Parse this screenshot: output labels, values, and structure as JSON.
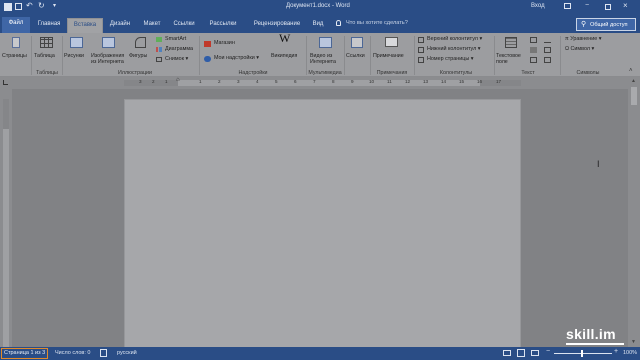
{
  "window": {
    "title": "Документ1.docx - Word",
    "sign_in": "Вход",
    "qat": {
      "save": "save",
      "undo": "undo",
      "redo": "redo"
    }
  },
  "tabs": [
    {
      "label": "Файл"
    },
    {
      "label": "Главная"
    },
    {
      "label": "Вставка"
    },
    {
      "label": "Дизайн"
    },
    {
      "label": "Макет"
    },
    {
      "label": "Ссылки"
    },
    {
      "label": "Рассылки"
    },
    {
      "label": "Рецензирование"
    },
    {
      "label": "Вид"
    }
  ],
  "tell_me": "Что вы хотите сделать?",
  "share": "Общий доступ",
  "ribbon": {
    "pages": {
      "button": "Страницы",
      "group": ""
    },
    "tables": {
      "button": "Таблица",
      "group": "Таблицы"
    },
    "illustrations": {
      "pictures": "Рисунки",
      "online_pictures_1": "Изображения",
      "online_pictures_2": "из Интернета",
      "shapes": "Фигуры",
      "smartart": "SmartArt",
      "chart": "Диаграмма",
      "screenshot": "Снимок",
      "group": "Иллюстрации"
    },
    "addins": {
      "store": "Магазин",
      "my_addins": "Мои надстройки",
      "wikipedia": "Википедия",
      "group": "Надстройки"
    },
    "media": {
      "online_video_1": "Видео из",
      "online_video_2": "Интернета",
      "group": "Мультимедиа"
    },
    "links": {
      "links": "Ссылки",
      "group": ""
    },
    "comments": {
      "comment": "Примечание",
      "group": "Примечания"
    },
    "header_footer": {
      "header": "Верхний колонтитул",
      "footer": "Нижний колонтитул",
      "page_number": "Номер страницы",
      "group": "Колонтитулы"
    },
    "text": {
      "textbox_1": "Текстовое",
      "textbox_2": "поле",
      "group": "Текст"
    },
    "symbols": {
      "equation": "Уравнение",
      "symbol": "Символ",
      "group": "Символы"
    }
  },
  "ruler_numbers": [
    "3",
    "2",
    "1",
    "1",
    "2",
    "3",
    "4",
    "5",
    "6",
    "7",
    "8",
    "9",
    "10",
    "11",
    "12",
    "13",
    "14",
    "15",
    "16",
    "17"
  ],
  "status": {
    "page": "Страница 1 из 3",
    "words": "Число слов: 0",
    "language": "русский",
    "zoom": "100%"
  },
  "watermark": "skill.im",
  "colors": {
    "title_bar": "#2a4d86",
    "ribbon": "#9c9da0",
    "page": "#a6a7aa",
    "highlight": "#e08a2a"
  }
}
